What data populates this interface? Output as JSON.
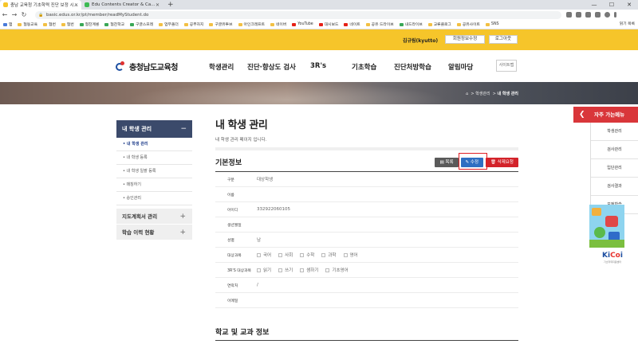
{
  "browser": {
    "tabs": [
      {
        "title": "충남 교육청 기초학력 진단 보정 시...",
        "active": true
      },
      {
        "title": "Edu Contents Creator & Ca...",
        "active": false
      }
    ],
    "url": "basic.edus.or.kr/pt/member/readMyStudent.do",
    "bookmarks": [
      "앱",
      "협동교육",
      "협번",
      "협번",
      "협찬계룡",
      "협찬학교",
      "구글스프레",
      "업무폴더",
      "공부자지",
      "구글유투브",
      "아인크래프트",
      "네이버",
      "YouTube",
      "대시보드",
      "네이트",
      "공유 드라이브",
      "내드라이브",
      "교류클로그",
      "공유사이트",
      "SNS"
    ],
    "bookmarks_end": "읽기 목록"
  },
  "topbar": {
    "user": "김규림(kyutto)",
    "edit_info": "회원정보수정",
    "logout": "로그아웃"
  },
  "header": {
    "logo": "충청남도교육청",
    "menu": [
      "학생관리",
      "진단·향상도 검사",
      "3R's",
      "기초학습",
      "진단처방학습",
      "알림마당"
    ],
    "sitemap": "사이트맵"
  },
  "breadcrumb": {
    "home": "⌂",
    "items": [
      "학생관리",
      "내 학생 관리"
    ]
  },
  "sidebar": {
    "title": "내 학생 관리",
    "toggle": "−",
    "items": [
      "• 내 학생 관리",
      "• 내 학생 등록",
      "• 내 학생 일괄 등록",
      "• 매칭하기",
      "• 승인관리"
    ],
    "groups": [
      {
        "label": "지도계획서 관리",
        "toggle": "+"
      },
      {
        "label": "학습 이력 현황",
        "toggle": "+"
      }
    ]
  },
  "main": {
    "title": "내 학생 관리",
    "desc": "내 학생 관리 페이지 입니다.",
    "section": "기본정보",
    "buttons": {
      "list": "▤ 목록",
      "edit": "✎ 수정",
      "delete": "🗑 삭제요청"
    },
    "rows": [
      {
        "label": "구분",
        "value": "대상학생"
      },
      {
        "label": "이름",
        "value": ""
      },
      {
        "label": "아이디",
        "value": "332922060105"
      },
      {
        "label": "생년월일",
        "value": ""
      },
      {
        "label": "성별",
        "value": "남"
      },
      {
        "label": "대상과목",
        "options": [
          "국어",
          "사회",
          "수학",
          "과학",
          "영어"
        ]
      },
      {
        "label": "3R'S 대상과목",
        "options": [
          "읽기",
          "쓰기",
          "셈하기",
          "기초영어"
        ]
      },
      {
        "label": "연락처",
        "value": "/"
      },
      {
        "label": "이메일",
        "value": ""
      }
    ],
    "section2": "학교 및 교과 정보"
  },
  "quick": {
    "title": "자주 가는메뉴",
    "arrow": "❮",
    "items": [
      "학생관리",
      "검사관리",
      "입단관리",
      "검사결과",
      "보정학습"
    ],
    "kicoi_a": "Ki",
    "kicoi_b": "Co",
    "kicoi_c": "i",
    "kicoi_sub": "기초학력지원센터"
  }
}
